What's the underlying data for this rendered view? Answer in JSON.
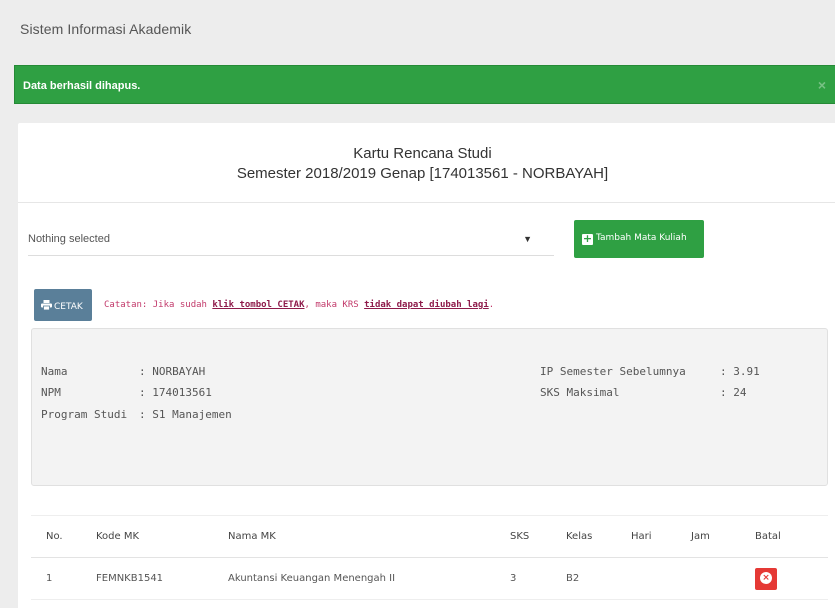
{
  "app": {
    "title": "Sistem Informasi Akademik"
  },
  "alert": {
    "message": "Data berhasil dihapus.",
    "close": "×",
    "color": "#2fa043"
  },
  "header": {
    "title": "Kartu Rencana Studi",
    "subtitle": "Semester 2018/2019 Genap [174013561 - NORBAYAH]"
  },
  "course_select": {
    "value": "Nothing selected",
    "caret": "▼"
  },
  "add_button": {
    "icon": "+",
    "label": "Tambah Mata Kuliah"
  },
  "print_button": {
    "icon": "printer-icon",
    "label": "CETAK"
  },
  "note": {
    "prefix": "Catatan: Jika sudah ",
    "link1": "klik tombol CETAK",
    "middle": ", maka KRS ",
    "link2": "tidak dapat diubah lagi",
    "suffix": "."
  },
  "student": {
    "nama_label": "Nama",
    "nama_value": ": NORBAYAH",
    "npm_label": "NPM",
    "npm_value": ": 174013561",
    "prodi_label": "Program Studi",
    "prodi_value": ": S1 Manajemen",
    "ip_label": "IP Semester Sebelumnya",
    "ip_value": ": 3.91",
    "sks_label": "SKS Maksimal",
    "sks_value": ": 24"
  },
  "table": {
    "headers": [
      "No.",
      "Kode MK",
      "Nama MK",
      "SKS",
      "Kelas",
      "Hari",
      "Jam",
      "Batal"
    ],
    "rows": [
      {
        "no": "1",
        "kode": "FEMNKB1541",
        "nama": "Akuntansi Keuangan Menengah II",
        "sks": "3",
        "kelas": "B2",
        "hari": "",
        "jam": ""
      }
    ]
  }
}
